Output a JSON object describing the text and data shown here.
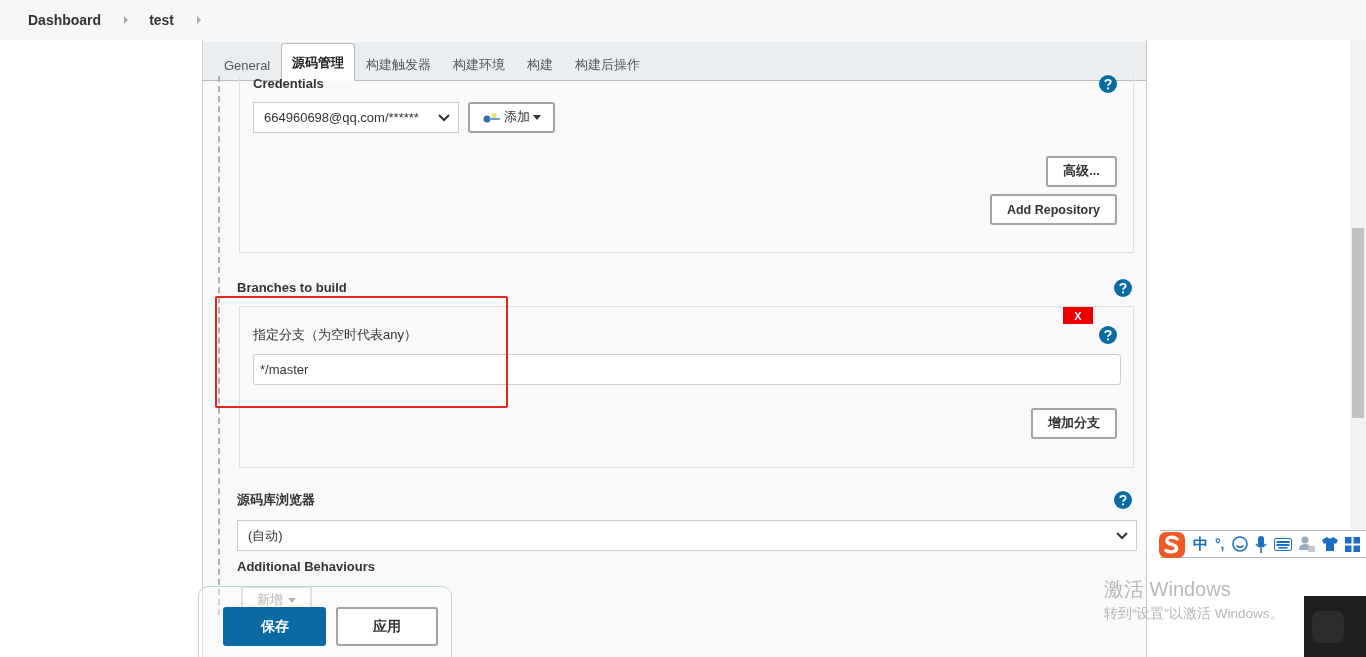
{
  "breadcrumb": [
    {
      "label": "Dashboard"
    },
    {
      "label": "test"
    }
  ],
  "tabs": [
    {
      "label": "General",
      "selected": false
    },
    {
      "label": "源码管理",
      "selected": true
    },
    {
      "label": "构建触发器",
      "selected": false
    },
    {
      "label": "构建环境",
      "selected": false
    },
    {
      "label": "构建",
      "selected": false
    },
    {
      "label": "构建后操作",
      "selected": false
    }
  ],
  "repository": {
    "credentials_label": "Credentials",
    "credentials_value": "664960698@qq.com/******",
    "add_button": "添加",
    "advanced_button": "高级...",
    "add_repository_button": "Add Repository"
  },
  "branches": {
    "title": "Branches to build",
    "delete_button": "X",
    "branch_label": "指定分支（为空时代表any）",
    "branch_value": "*/master",
    "add_branch_button": "增加分支"
  },
  "repo_browser": {
    "label": "源码库浏览器",
    "value": "(自动)"
  },
  "additional_behaviours": {
    "label": "Additional Behaviours",
    "add_button": "新增",
    "disabled": true
  },
  "save_bar": {
    "save_button": "保存",
    "apply_button": "应用"
  },
  "ime_toolbar": {
    "mode": "中",
    "punctuation": "°,"
  },
  "activation_notice": {
    "title": "激活 Windows",
    "subtitle": "转到“设置”以激活 Windows。"
  }
}
